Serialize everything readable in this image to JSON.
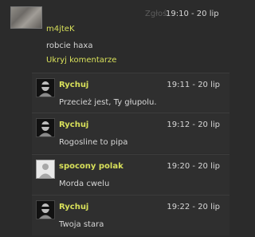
{
  "main_comment": {
    "report_label": "Zgłoś",
    "timestamp": "19:10 - 20 lip",
    "username": "m4jteK",
    "text": "robcie haxa",
    "hide_link": "Ukryj komentarze"
  },
  "replies": [
    {
      "username": "Rychuj",
      "timestamp": "19:11 - 20 lip",
      "text": "Przecież jest, Ty głupolu.",
      "avatar": "dark-face-avatar"
    },
    {
      "username": "Rychuj",
      "timestamp": "19:12 - 20 lip",
      "text": "Rogosline to pipa",
      "avatar": "dark-face-avatar"
    },
    {
      "username": "spocony polak",
      "timestamp": "19:20 - 20 lip",
      "text": "Morda cwelu",
      "avatar": "default-user-avatar"
    },
    {
      "username": "Rychuj",
      "timestamp": "19:22 - 20 lip",
      "text": "Twoja stara",
      "avatar": "dark-face-avatar"
    }
  ]
}
